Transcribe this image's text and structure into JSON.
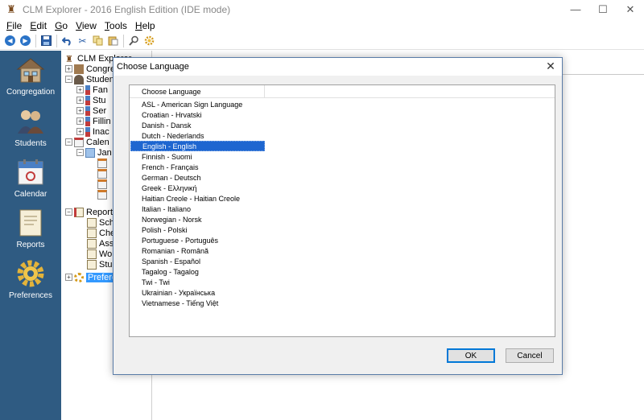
{
  "window": {
    "title": "CLM Explorer - 2016 English Edition (IDE mode)",
    "minimize": "—",
    "maximize": "☐",
    "close": "✕"
  },
  "menu": [
    {
      "label": "File",
      "accel": "F",
      "rest": "ile"
    },
    {
      "label": "Edit",
      "accel": "E",
      "rest": "dit"
    },
    {
      "label": "Go",
      "accel": "G",
      "rest": "o"
    },
    {
      "label": "View",
      "accel": "V",
      "rest": "iew"
    },
    {
      "label": "Tools",
      "accel": "T",
      "rest": "ools"
    },
    {
      "label": "Help",
      "accel": "H",
      "rest": "elp"
    }
  ],
  "nav": {
    "congregation": "Congregation",
    "students": "Students",
    "calendar": "Calendar",
    "reports": "Reports",
    "preferences": "Preferences"
  },
  "tree": {
    "root": "CLM Explorer",
    "congregation": "Congre",
    "students": "Studen",
    "fam": "Fan",
    "stu": "Stu",
    "ser": "Ser",
    "fill": "Fillin",
    "inac": "Inac",
    "calendar": "Calen",
    "jan": "Jan",
    "reports": "Report",
    "sch": "Sch",
    "che": "Che",
    "ass": "Ass",
    "wo": "Wo",
    "stud": "Stud",
    "prefs": "Prefere"
  },
  "dialog": {
    "title": "Choose Language",
    "close": "✕",
    "column_header": "Choose Language",
    "languages": [
      "ASL - American Sign Language",
      "Croatian - Hrvatski",
      "Danish - Dansk",
      "Dutch - Nederlands",
      "English - English",
      "Finnish - Suomi",
      "French - Français",
      "German - Deutsch",
      "Greek - Ελληνική",
      "Haitian Creole - Haitian Creole",
      "Italian - Italiano",
      "Norwegian - Norsk",
      "Polish - Polski",
      "Portuguese - Português",
      "Romanian - Română",
      "Spanish - Español",
      "Tagalog - Tagalog",
      "Twi - Twi",
      "Ukrainian - Українська",
      "Vietnamese - Tiếng Việt"
    ],
    "selected_index": 4,
    "ok_label": "OK",
    "cancel_label": "Cancel"
  },
  "colors": {
    "nav_bg": "#2f5b82",
    "selection": "#1e66d0",
    "accent": "#0078d7"
  }
}
